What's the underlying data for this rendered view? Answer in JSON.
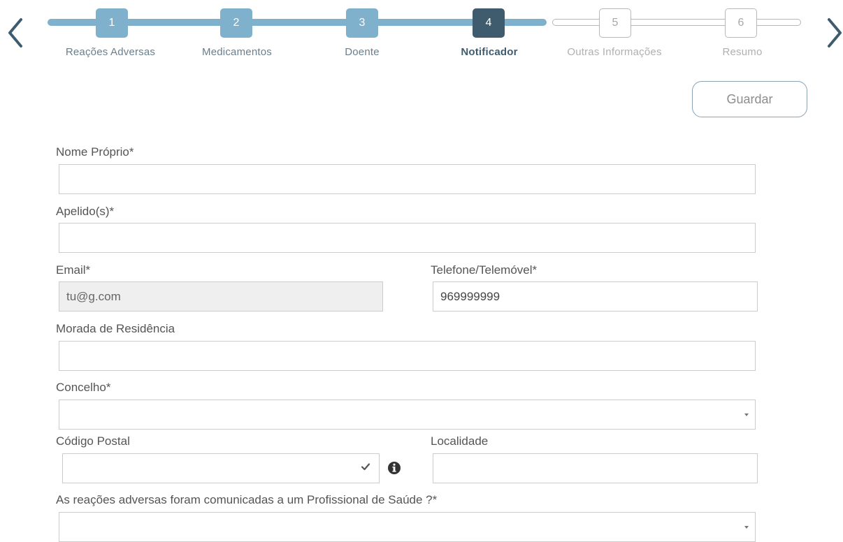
{
  "wizard": {
    "steps": [
      {
        "number": "1",
        "label": "Reações Adversas",
        "state": "done"
      },
      {
        "number": "2",
        "label": "Medicamentos",
        "state": "done"
      },
      {
        "number": "3",
        "label": "Doente",
        "state": "done"
      },
      {
        "number": "4",
        "label": "Notificador",
        "state": "active"
      },
      {
        "number": "5",
        "label": "Outras Informações",
        "state": "todo"
      },
      {
        "number": "6",
        "label": "Resumo",
        "state": "todo"
      }
    ],
    "prev_icon": "chevron-left-icon",
    "next_icon": "chevron-right-icon"
  },
  "toolbar": {
    "save_label": "Guardar"
  },
  "form": {
    "first_name": {
      "label": "Nome Próprio*",
      "value": ""
    },
    "surname": {
      "label": "Apelido(s)*",
      "value": ""
    },
    "email": {
      "label": "Email*",
      "value": "tu@g.com"
    },
    "phone": {
      "label": "Telefone/Telemóvel*",
      "value": "969999999"
    },
    "address": {
      "label": "Morada de Residência",
      "value": ""
    },
    "municipality": {
      "label": "Concelho*",
      "value": ""
    },
    "postal_code": {
      "label": "Código Postal",
      "value": ""
    },
    "locality": {
      "label": "Localidade",
      "value": ""
    },
    "reported_to_professional": {
      "label": "As reações adversas foram comunicadas a um Profissional de Saúde ?*",
      "value": ""
    }
  },
  "icons": {
    "check": "check-icon",
    "info": "info-circle-icon",
    "dropdown": "caret-down-icon"
  },
  "colors": {
    "step_done": "#7fb0cc",
    "step_active": "#3f5c6e",
    "step_todo_border": "#b8b8b8",
    "arrow": "#3f5c6e"
  }
}
